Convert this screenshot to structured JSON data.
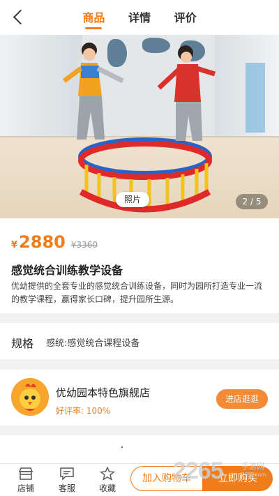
{
  "header": {
    "tabs": [
      {
        "label": "商品",
        "active": true
      },
      {
        "label": "详情",
        "active": false
      },
      {
        "label": "评价",
        "active": false
      }
    ]
  },
  "gallery": {
    "photo_tag": "照片",
    "page_indicator": "2 / 5"
  },
  "product": {
    "price_symbol": "¥",
    "price": "2880",
    "original_price": "¥3360",
    "title": "感觉统合训练教学设备",
    "description": "优幼提供的全套专业的感觉统合训练设备，同时为园所打造专业一流的教学课程，赢得家长口碑，提升园所生源。"
  },
  "spec": {
    "label": "规格",
    "value": "感统:感觉统合课程设备"
  },
  "shop": {
    "name": "优幼园本特色旗舰店",
    "rating": "好评率: 100%",
    "visit_button": "进店逛逛"
  },
  "bottom_bar": {
    "items": [
      {
        "label": "店铺",
        "icon": "store-icon"
      },
      {
        "label": "客服",
        "icon": "chat-icon"
      },
      {
        "label": "收藏",
        "icon": "star-icon"
      }
    ],
    "add_to_cart": "加入购物车",
    "buy_now": "立即购买"
  },
  "watermark": {
    "number": "2265",
    "site": "手游网",
    "url": "2265.com"
  },
  "colors": {
    "accent": "#f07d1c",
    "shop_button": "#f28a36"
  }
}
